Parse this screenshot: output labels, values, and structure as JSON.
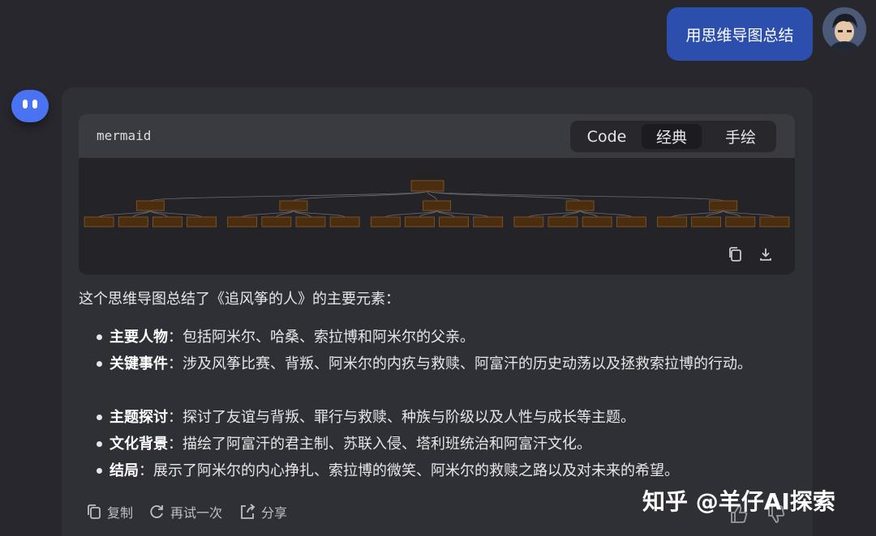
{
  "user_message": {
    "text": "用思维导图总结"
  },
  "code_block": {
    "lang": "mermaid",
    "tabs": [
      {
        "label": "Code",
        "active": false
      },
      {
        "label": "经典",
        "active": true
      },
      {
        "label": "手绘",
        "active": false
      }
    ],
    "actions": [
      {
        "icon": "copy-icon"
      },
      {
        "icon": "download-icon"
      }
    ]
  },
  "mindmap": {
    "root": "",
    "branches": [
      {
        "children": 4
      },
      {
        "children": 4
      },
      {
        "children": 4
      },
      {
        "children": 4
      },
      {
        "children": 4
      }
    ]
  },
  "response": {
    "intro": "这个思维导图总结了《追风筝的人》的主要元素：",
    "bullets": [
      {
        "term": "主要人物",
        "desc": "：包括阿米尔、哈桑、索拉博和阿米尔的父亲。"
      },
      {
        "term": "关键事件",
        "desc": "：涉及风筝比赛、背叛、阿米尔的内疚与救赎、阿富汗的历史动荡以及拯救索拉博的行动。"
      },
      {
        "term": "主题探讨",
        "desc": "：探讨了友谊与背叛、罪行与救赎、种族与阶级以及人性与成长等主题。"
      },
      {
        "term": "文化背景",
        "desc": "：描绘了阿富汗的君主制、苏联入侵、塔利班统治和阿富汗文化。"
      },
      {
        "term": "结局",
        "desc": "：展示了阿米尔的内心挣扎、索拉博的微笑、阿米尔的救赎之路以及对未来的希望。"
      }
    ]
  },
  "footer": {
    "copy_label": "复制",
    "retry_label": "再试一次",
    "share_label": "分享"
  },
  "watermark": "知乎 @羊仔AI探索",
  "colors": {
    "background": "#27272d",
    "card": "#2f2f36",
    "user_bubble": "#2c4fae",
    "bot_avatar": "#4a73f2",
    "node_fill": "#4a2e0f",
    "node_stroke": "#8a5a23"
  }
}
